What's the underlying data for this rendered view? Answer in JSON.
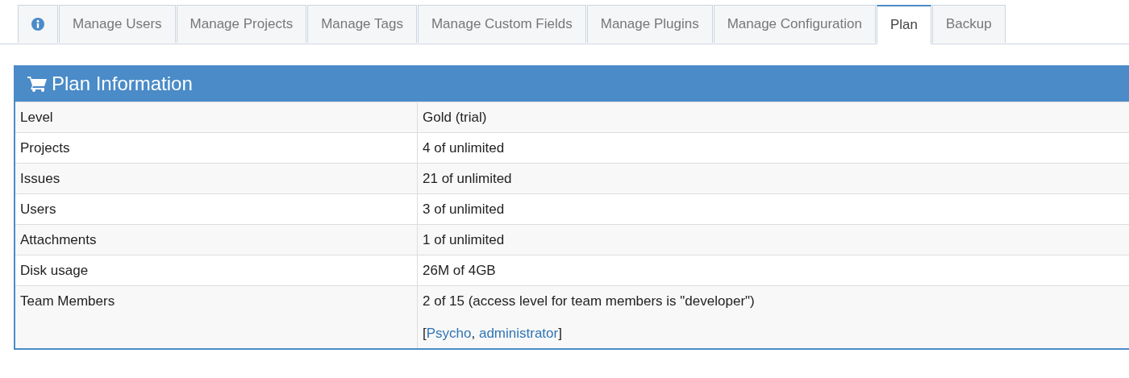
{
  "tabs": [
    {
      "kind": "icon",
      "selected": false
    },
    {
      "label": "Manage Users",
      "selected": false
    },
    {
      "label": "Manage Projects",
      "selected": false
    },
    {
      "label": "Manage Tags",
      "selected": false
    },
    {
      "label": "Manage Custom Fields",
      "selected": false
    },
    {
      "label": "Manage Plugins",
      "selected": false
    },
    {
      "label": "Manage Configuration",
      "selected": false
    },
    {
      "label": "Plan",
      "selected": true
    },
    {
      "label": "Backup",
      "selected": false
    }
  ],
  "panel": {
    "title": "Plan Information",
    "rows": [
      {
        "label": "Level",
        "value": "Gold (trial)"
      },
      {
        "label": "Projects",
        "value": "4 of unlimited"
      },
      {
        "label": "Issues",
        "value": "21 of unlimited"
      },
      {
        "label": "Users",
        "value": "3 of unlimited"
      },
      {
        "label": "Attachments",
        "value": "1 of unlimited"
      },
      {
        "label": "Disk usage",
        "value": "26M of 4GB"
      },
      {
        "label": "Team Members",
        "value": "2 of 15 (access level for team members is \"developer\")",
        "members": {
          "open": "[",
          "links": [
            "Psycho",
            "administrator"
          ],
          "separator": ", ",
          "close": "]"
        }
      }
    ]
  }
}
